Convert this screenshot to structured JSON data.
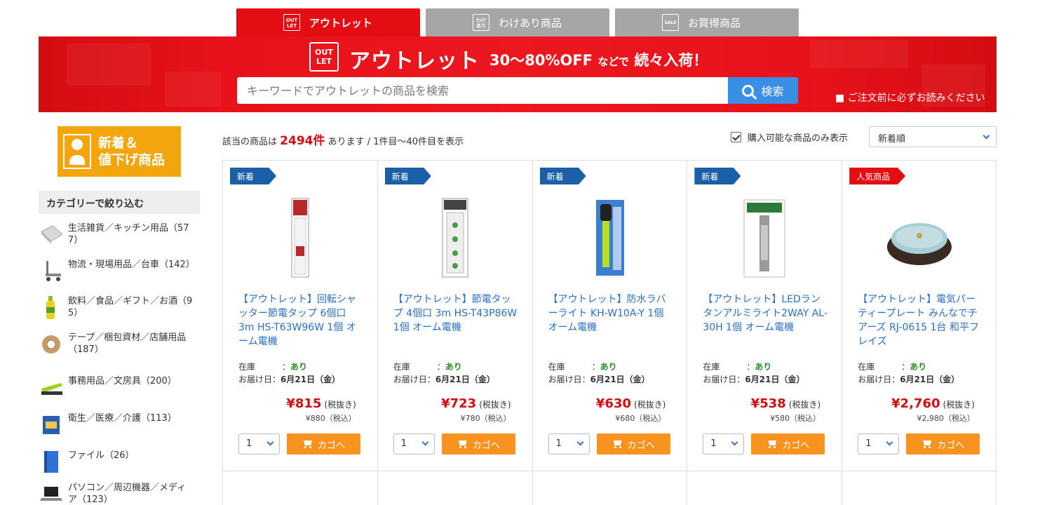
{
  "tabs": [
    {
      "label": "アウトレット",
      "icon_top": "OUT",
      "icon_bottom": "LET",
      "active": true
    },
    {
      "label": "わけあり商品",
      "icon_top": "わけ",
      "icon_bottom": "あり",
      "active": false
    },
    {
      "label": "お買得商品",
      "icon_top": "SALE",
      "icon_bottom": "",
      "active": false
    }
  ],
  "banner": {
    "logo_top": "OUT",
    "logo_bottom": "LET",
    "title": "アウトレット",
    "off_text": "30〜80%OFF",
    "off_suffix_small": "などで",
    "off_suffix": "続々入荷！",
    "search_placeholder": "キーワードでアウトレットの商品を検索",
    "search_button": "検索",
    "notice": "■ ご注文前に必ずお読みください"
  },
  "sidebar": {
    "promo_line1": "新着＆",
    "promo_line2": "値下げ商品",
    "category_heading": "カテゴリーで絞り込む",
    "categories": [
      {
        "label": "生活雑貨／キッチン用品（577）",
        "icon": "kitchen-icon"
      },
      {
        "label": "物流・現場用品／台車（142）",
        "icon": "cart-truck-icon"
      },
      {
        "label": "飲料／食品／ギフト／お酒（95）",
        "icon": "bottle-icon"
      },
      {
        "label": "テープ／梱包資材／店舗用品（187）",
        "icon": "tape-icon"
      },
      {
        "label": "事務用品／文房具（200）",
        "icon": "stapler-icon"
      },
      {
        "label": "衛生／医療／介護（113）",
        "icon": "medical-icon"
      },
      {
        "label": "ファイル（26）",
        "icon": "file-icon"
      },
      {
        "label": "パソコン／周辺機器／メディア（123）",
        "icon": "laptop-icon"
      }
    ]
  },
  "results": {
    "prefix": "該当の商品は",
    "count": "2494件",
    "suffix": "あります / 1件目〜40件目を表示",
    "filter_label": "購入可能な商品のみ表示",
    "sort_value": "新着順"
  },
  "products": [
    {
      "badge": "新着",
      "badge_type": "new",
      "name": "【アウトレット】回転シャッター節電タップ 6個口 3m HS-T63W96W 1個 オーム電機",
      "stock_label": "在庫",
      "stock_value": "あり",
      "delivery_label": "お届け日",
      "delivery_value": "6月21日（金）",
      "price": "¥815",
      "price_ex": "(税抜き)",
      "price_inc": "¥880（税込）",
      "qty": "1",
      "cart_label": "カゴへ",
      "image": "power-strip-red"
    },
    {
      "badge": "新着",
      "badge_type": "new",
      "name": "【アウトレット】節電タップ 4個口 3m HS-T43P86W 1個 オーム電機",
      "stock_label": "在庫",
      "stock_value": "あり",
      "delivery_label": "お届け日",
      "delivery_value": "6月21日（金）",
      "price": "¥723",
      "price_ex": "(税抜き)",
      "price_inc": "¥780（税込）",
      "qty": "1",
      "cart_label": "カゴへ",
      "image": "power-strip-green"
    },
    {
      "badge": "新着",
      "badge_type": "new",
      "name": "【アウトレット】防水ラバーライト KH-W10A-Y 1個 オーム電機",
      "stock_label": "在庫",
      "stock_value": "あり",
      "delivery_label": "お届け日",
      "delivery_value": "6月21日（金）",
      "price": "¥630",
      "price_ex": "(税抜き)",
      "price_inc": "¥680（税込）",
      "qty": "1",
      "cart_label": "カゴへ",
      "image": "flashlight"
    },
    {
      "badge": "新着",
      "badge_type": "new",
      "name": "【アウトレット】LEDランタンアルミライト2WAY AL-30H 1個 オーム電機",
      "stock_label": "在庫",
      "stock_value": "あり",
      "delivery_label": "お届け日",
      "delivery_value": "6月21日（金）",
      "price": "¥538",
      "price_ex": "(税抜き)",
      "price_inc": "¥580（税込）",
      "qty": "1",
      "cart_label": "カゴへ",
      "image": "lantern"
    },
    {
      "badge": "人気商品",
      "badge_type": "pop",
      "name": "【アウトレット】電気パーティープレート みんなでチアーズ RJ-0615 1台 和平フレイズ",
      "stock_label": "在庫",
      "stock_value": "あり",
      "delivery_label": "お届け日",
      "delivery_value": "6月21日（金）",
      "price": "¥2,760",
      "price_ex": "(税抜き)",
      "price_inc": "¥2,980（税込）",
      "qty": "1",
      "cart_label": "カゴへ",
      "image": "hot-plate"
    }
  ]
}
